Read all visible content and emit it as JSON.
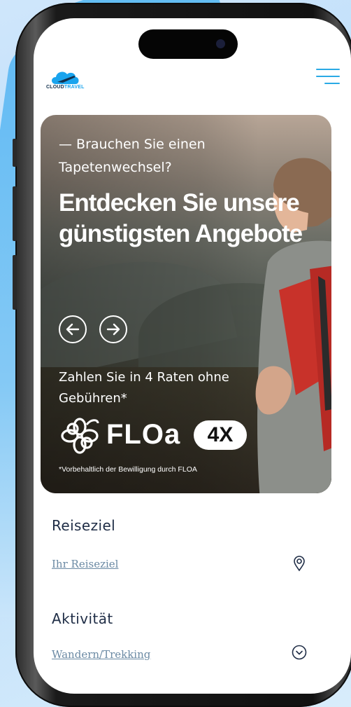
{
  "header": {
    "logo_text_primary": "CLOUD",
    "logo_text_accent": "TRAVEL",
    "menu_icon": "hamburger-menu-icon"
  },
  "hero": {
    "kicker": "— Brauchen Sie einen Tapetenwechsel?",
    "title": "Entdecken Sie unsere günstigsten Angebote",
    "prev_icon": "arrow-left-circle-icon",
    "next_icon": "arrow-right-circle-icon",
    "payment_text": "Zahlen Sie in 4 Raten ohne Gebühren*",
    "floa_word": "FLOa",
    "floa_badge": "4X",
    "disclaimer": "*Vorbehaltlich der Bewilligung durch FLOA"
  },
  "form": {
    "destination_label": "Reiseziel",
    "destination_placeholder": "Ihr Reiseziel",
    "destination_icon": "location-pin-icon",
    "activity_label": "Aktivität",
    "activity_value": "Wandern/Trekking",
    "activity_icon": "chevron-down-circle-icon"
  },
  "colors": {
    "brand_blue": "#1aa4ee",
    "menu_blue": "#2aaae5",
    "label_navy": "#1f2d46",
    "input_text": "#6b8aa4"
  }
}
